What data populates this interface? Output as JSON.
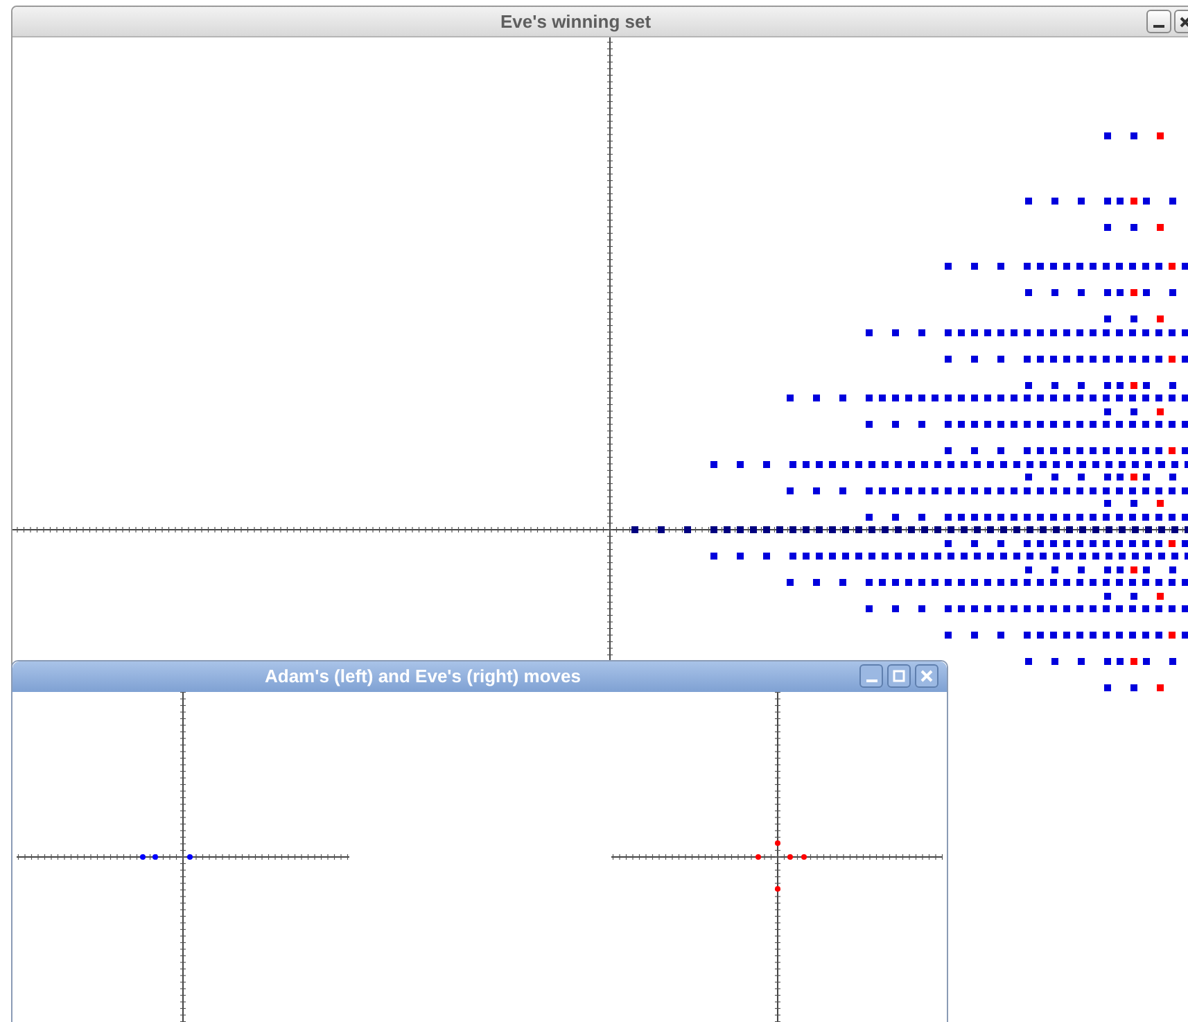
{
  "windows": [
    {
      "title": "Eve's winning set"
    },
    {
      "title": "Adam's (left) and Eve's (right) moves"
    }
  ]
}
